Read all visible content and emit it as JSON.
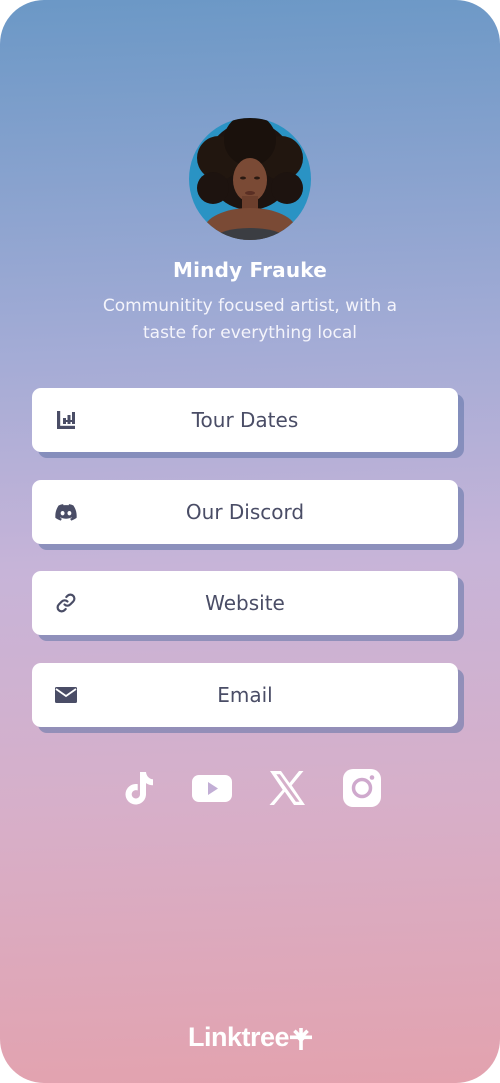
{
  "profile": {
    "name": "Mindy Frauke",
    "bio_line1": "Communitity focused artist, with a",
    "bio_line2": "taste for everything local"
  },
  "links": [
    {
      "label": "Tour Dates",
      "icon": "tour-dates-icon"
    },
    {
      "label": "Our Discord",
      "icon": "discord-icon"
    },
    {
      "label": "Website",
      "icon": "link-icon"
    },
    {
      "label": "Email",
      "icon": "envelope-icon"
    }
  ],
  "social": [
    {
      "icon": "tiktok-icon"
    },
    {
      "icon": "youtube-icon"
    },
    {
      "icon": "x-icon"
    },
    {
      "icon": "instagram-icon"
    }
  ],
  "footer": {
    "logo_text": "Linktree"
  },
  "colors": {
    "gradient_top": "#6b98c6",
    "gradient_bottom": "#e3a2ae",
    "button_bg": "#ffffff",
    "button_text": "#4a4d66",
    "button_shadow": "#5f73a5"
  }
}
